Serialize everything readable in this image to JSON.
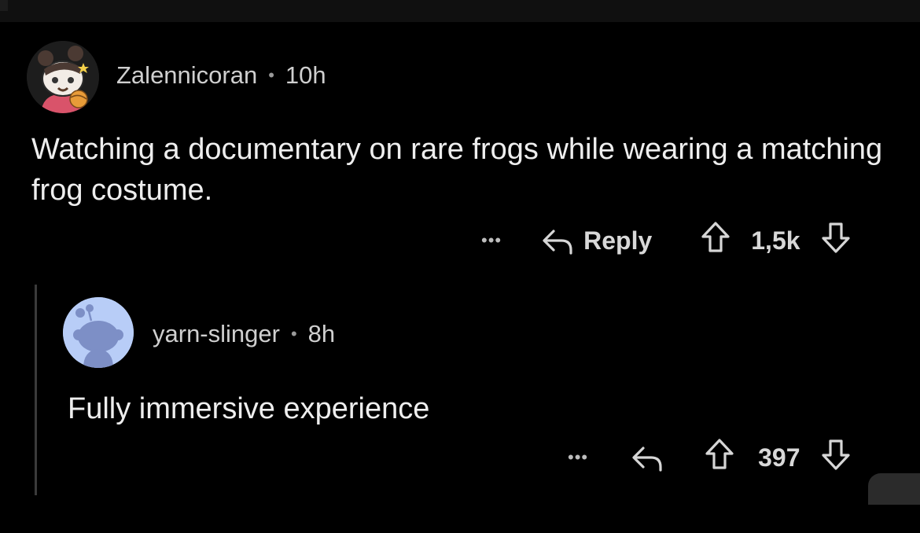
{
  "comments": {
    "parent": {
      "username": "Zalennicoran",
      "separator": "•",
      "time": "10h",
      "body": "Watching a documentary on rare frogs while wearing a matching frog costume.",
      "more_label": "•••",
      "reply_label": "Reply",
      "score": "1,5k",
      "avatar_icon": "snoo-avatar-buns-icon"
    },
    "reply": {
      "username": "yarn-slinger",
      "separator": "•",
      "time": "8h",
      "body": "Fully immersive experience",
      "more_label": "•••",
      "score": "397",
      "avatar_icon": "default-snoo-avatar-icon"
    }
  },
  "colors": {
    "background": "#000000",
    "text": "#eeeeee",
    "meta": "#cfcfcf",
    "thread_line": "#3a3a3a",
    "default_avatar_bg": "#b8cdf7"
  }
}
